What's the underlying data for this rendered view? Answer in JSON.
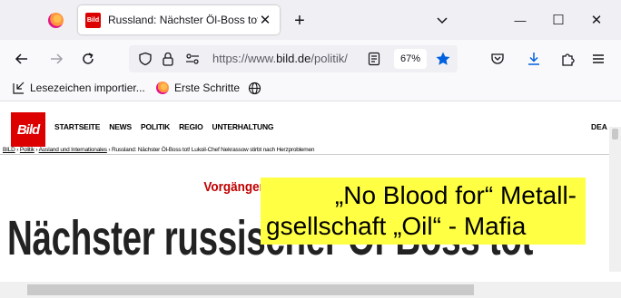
{
  "tabs": {
    "inactive_icon": "firefox-icon",
    "active": {
      "favicon_text": "Bild",
      "title": "Russland: Nächster Öl-Boss tot |",
      "close_label": "✕"
    },
    "new_tab_label": "+"
  },
  "window": {
    "minimize": "—",
    "maximize": "☐",
    "close": "✕"
  },
  "url": {
    "prefix": "https://www.",
    "domain": "bild.de",
    "path": "/politik/",
    "zoom": "67%"
  },
  "bookmarks": [
    {
      "label": "Lesezeichen importier..."
    },
    {
      "label": "Erste Schritte"
    }
  ],
  "site": {
    "logo": "Bild",
    "nav": [
      "STARTSEITE",
      "NEWS",
      "POLITIK",
      "REGIO",
      "UNTERHALTUNG"
    ],
    "nav_tail": "DEA",
    "breadcrumb": {
      "home": "BILD",
      "sep": " › ",
      "c1": "Politik",
      "c2": "Ausland und Internationales",
      "current": "Russland: Nächster Öl-Boss tot! Lukoil-Chef Nekrassow stirbt nach Herzproblemen"
    },
    "kicker": "Vorgänger starb bei Fenstersturz",
    "headline": "Nächster russischer Öl-Boss tot"
  },
  "overlay": {
    "line1": "„No Blood for“ Metall-",
    "line2": "gsellschaft „Oil“ - Mafia"
  },
  "colors": {
    "bild_red": "#dd0000",
    "kicker_red": "#c00000",
    "highlight_yellow": "#ffff44",
    "star_blue": "#0060df"
  }
}
